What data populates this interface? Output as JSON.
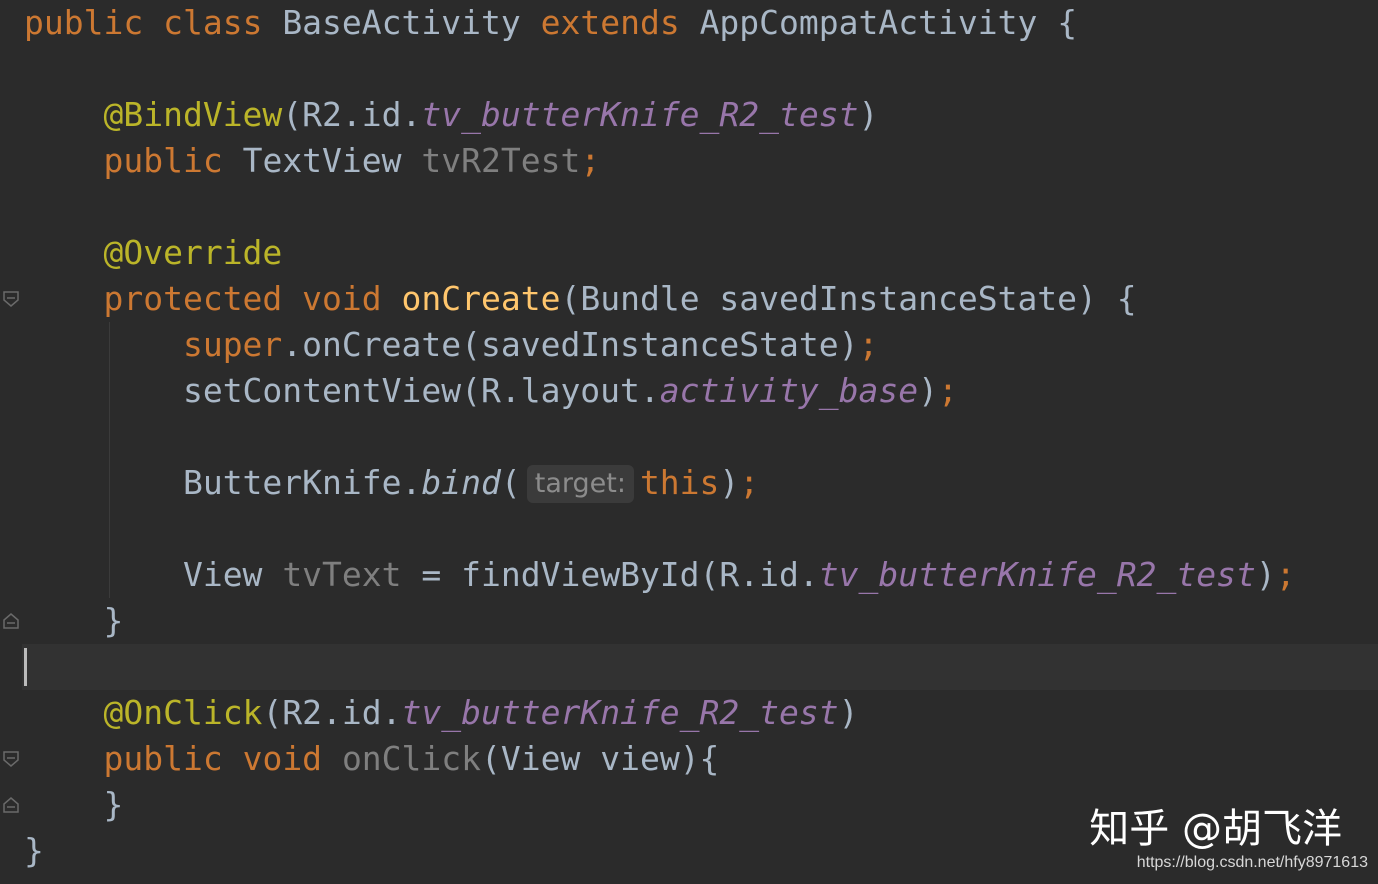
{
  "code": {
    "l1": {
      "k1": "public",
      "k2": "class",
      "name": "BaseActivity",
      "k3": "extends",
      "parent": "AppCompatActivity",
      "brace": "{"
    },
    "l3": {
      "annotation": "@BindView",
      "open": "(R2.id.",
      "field": "tv_butterKnife_R2_test",
      "close": ")"
    },
    "l4": {
      "kw": "public",
      "type": "TextView",
      "var": "tvR2Test",
      "semi": ";"
    },
    "l6": {
      "annotation": "@Override"
    },
    "l7": {
      "k1": "protected",
      "k2": "void",
      "method": "onCreate",
      "params": "(Bundle savedInstanceState) {"
    },
    "l8": {
      "kw": "super",
      "call": ".onCreate(savedInstanceState)",
      "semi": ";"
    },
    "l9": {
      "call": "setContentView(R.layout.",
      "field": "activity_base",
      "close": ")",
      "semi": ";"
    },
    "l11": {
      "obj": "ButterKnife.",
      "method": "bind",
      "open": "(",
      "hint": "target:",
      "kw": "this",
      "close": ")",
      "semi": ";"
    },
    "l13": {
      "type": "View",
      "var": "tvText",
      "assign": " = findViewById(R.id.",
      "field": "tv_butterKnife_R2_test",
      "close": ")",
      "semi": ";"
    },
    "l14": {
      "brace": "}"
    },
    "l16": {
      "annotation": "@OnClick",
      "open": "(R2.id.",
      "field": "tv_butterKnife_R2_test",
      "close": ")"
    },
    "l17": {
      "k1": "public",
      "k2": "void",
      "method": "onClick",
      "params": "(View view){"
    },
    "l18": {
      "brace": "}"
    },
    "l19": {
      "brace": "}"
    }
  },
  "watermark": "知乎 @胡飞洋",
  "source_url": "https://blog.csdn.net/hfy8971613"
}
